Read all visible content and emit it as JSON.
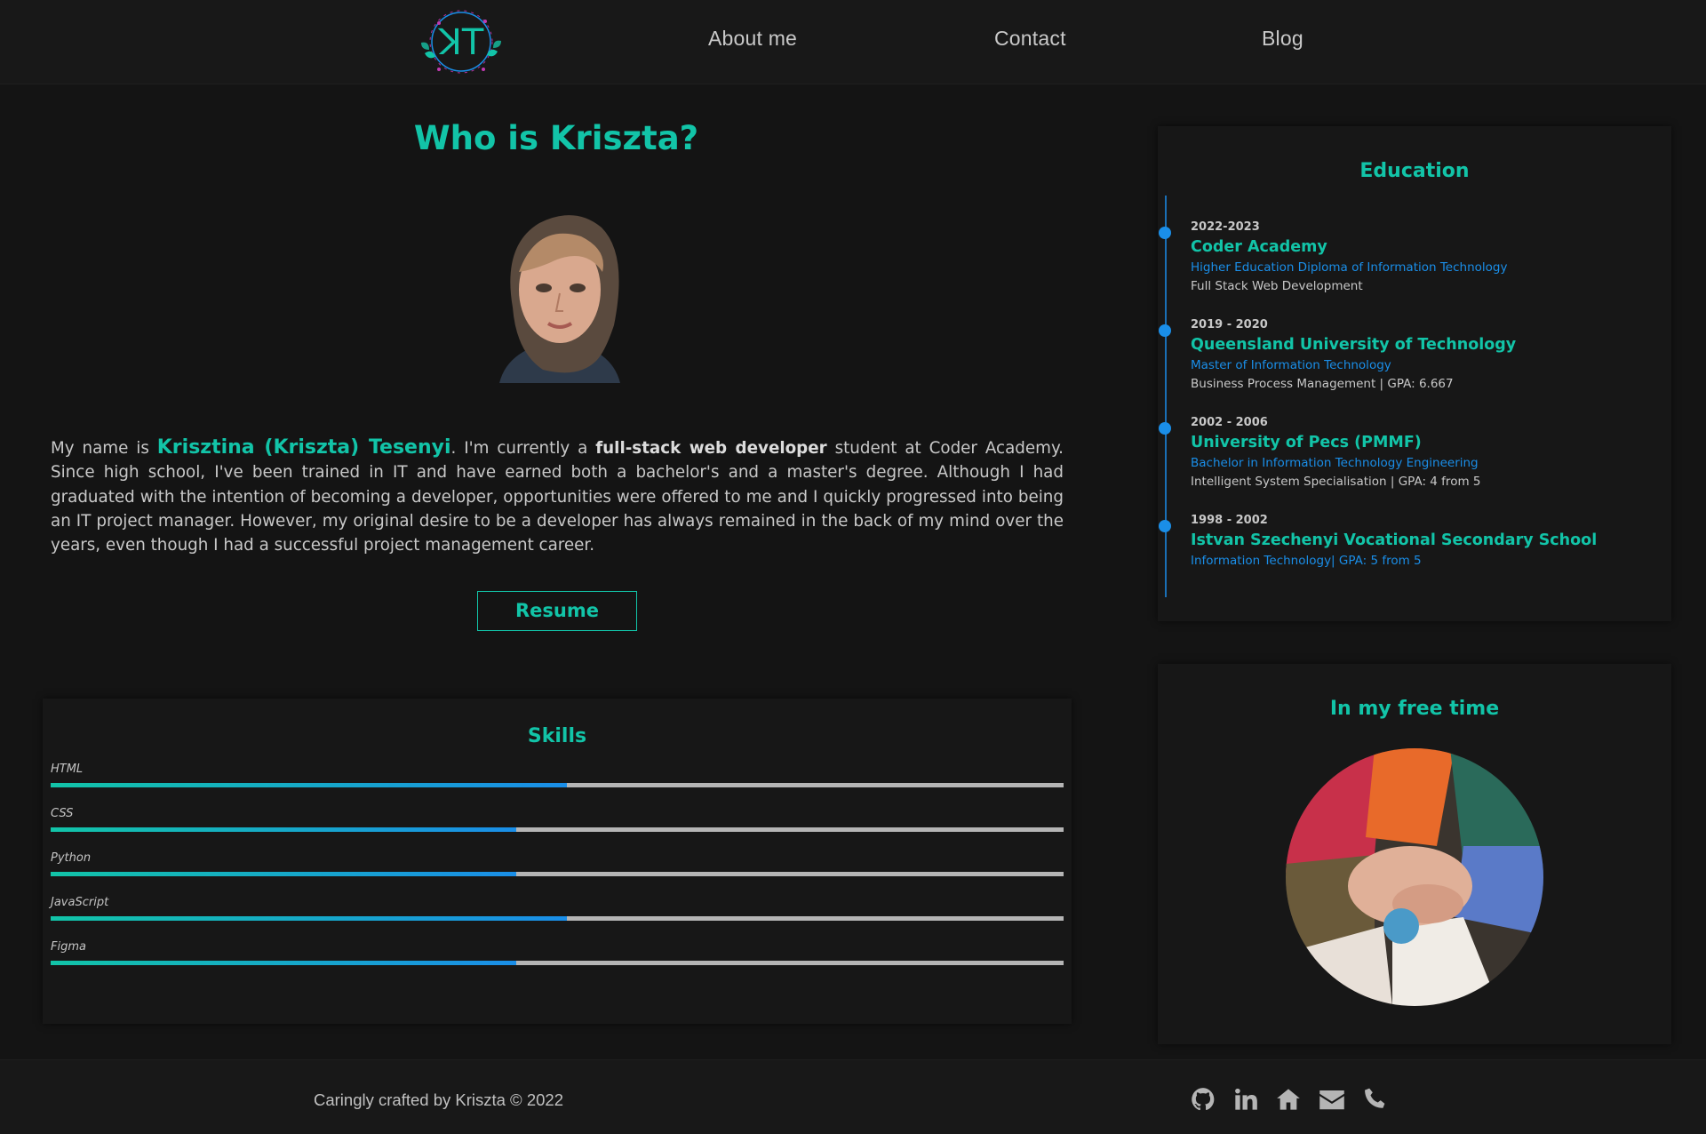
{
  "nav": {
    "logo_alt": "KT",
    "items": [
      {
        "label": "About me"
      },
      {
        "label": "Contact"
      },
      {
        "label": "Blog"
      }
    ]
  },
  "about": {
    "title": "Who is Kriszta?",
    "bio_prefix": "My name is ",
    "bio_name": "Krisztina (Kriszta) Tesenyi",
    "bio_mid": ". I'm currently a ",
    "bio_bold": "full-stack web developer",
    "bio_rest": " student at Coder Academy. Since high school, I've been trained in IT and have earned both a bachelor's and a master's degree. Although I had graduated with the intention of becoming a developer, opportunities were offered to me and I quickly progressed into being an IT project manager. However, my original desire to be a developer has always remained in the back of my mind over the years, even though I had a successful project management career.",
    "resume_label": "Resume"
  },
  "skills": {
    "title": "Skills",
    "items": [
      {
        "label": "HTML",
        "level": 0.51
      },
      {
        "label": "CSS",
        "level": 0.46
      },
      {
        "label": "Python",
        "level": 0.46
      },
      {
        "label": "JavaScript",
        "level": 0.51
      },
      {
        "label": "Figma",
        "level": 0.46
      }
    ]
  },
  "education": {
    "title": "Education",
    "entries": [
      {
        "years": "2022-2023",
        "school": "Coder Academy",
        "degree": "Higher Education Diploma of Information Technology",
        "detail": "Full Stack Web Development"
      },
      {
        "years": "2019 - 2020",
        "school": "Queensland University of Technology",
        "degree": "Master of Information Technology",
        "detail": "Business Process Management | GPA: 6.667"
      },
      {
        "years": "2002 - 2006",
        "school": "University of Pecs (PMMF)",
        "degree": "Bachelor in Information Technology Engineering",
        "detail": "Intelligent System Specialisation | GPA: 4 from 5"
      },
      {
        "years": "1998 - 2002",
        "school": "Istvan Szechenyi Vocational Secondary School",
        "degree": "Information Technology| GPA: 5 from 5",
        "detail": ""
      }
    ]
  },
  "free_time": {
    "title": "In my free time"
  },
  "footer": {
    "credit": "Caringly crafted by Kriszta © 2022",
    "icons": [
      "github-icon",
      "linkedin-icon",
      "home-icon",
      "email-icon",
      "phone-icon"
    ]
  },
  "colors": {
    "accent": "#12c4a8",
    "blue": "#1a8ee8",
    "background": "#141414"
  }
}
